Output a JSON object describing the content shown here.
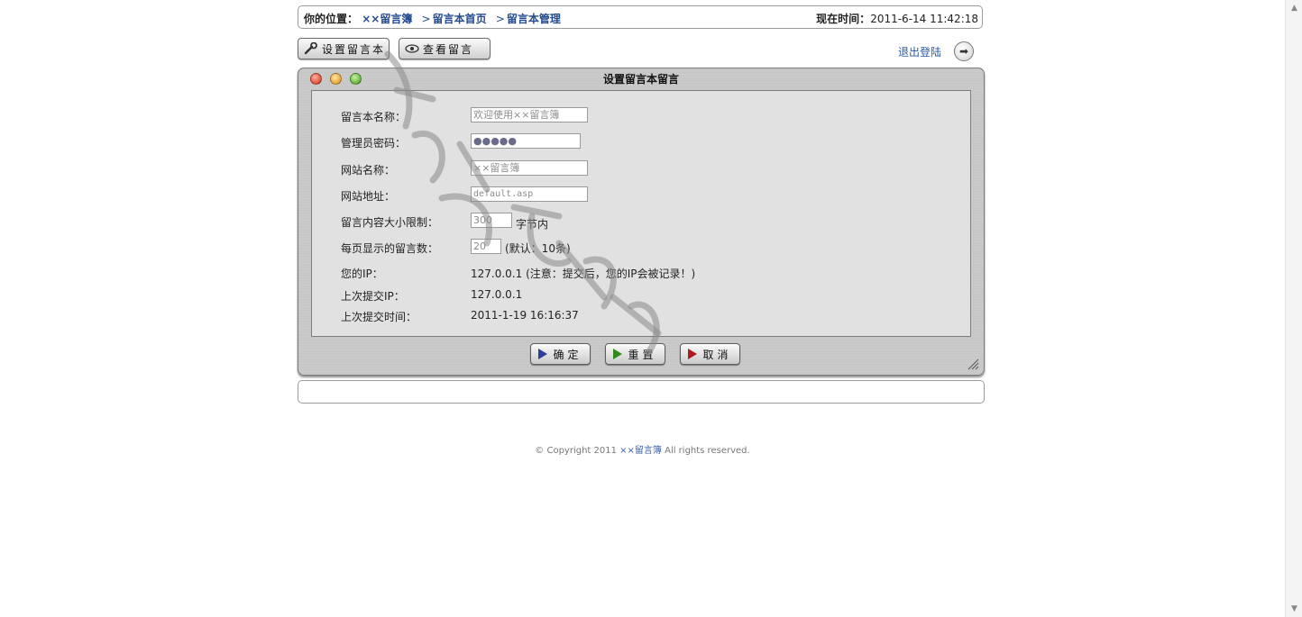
{
  "breadcrumb": {
    "label": "你的位置：",
    "items": [
      "××留言簿",
      "留言本首页",
      "留言本管理"
    ],
    "separator": ">"
  },
  "clock": {
    "label": "现在时间：",
    "value": "2011-6-14 11:42:18"
  },
  "toolbar": {
    "settings_label": "设置留言本",
    "view_label": "查看留言",
    "logout_label": "退出登陆"
  },
  "panel": {
    "title": "设置留言本留言",
    "fields": [
      {
        "label": "留言本名称：",
        "value": "欢迎使用××留言簿"
      },
      {
        "label": "管理员密码：",
        "value": "●●●●●"
      },
      {
        "label": "网站名称：",
        "value": "××留言簿"
      },
      {
        "label": "网站地址：",
        "value": "default.asp"
      },
      {
        "label": "留言内容大小限制：",
        "value": "300",
        "suffix": "字节内"
      },
      {
        "label": "每页显示的留言数：",
        "value": "20",
        "suffix": "(默认：10条)"
      }
    ],
    "info": [
      {
        "label": "您的IP：",
        "value": "127.0.0.1 (注意：提交后，您的IP会被记录！)"
      },
      {
        "label": "上次提交IP：",
        "value": "127.0.0.1"
      },
      {
        "label": "上次提交时间：",
        "value": "2011-1-19 16:16:37"
      }
    ],
    "buttons": {
      "confirm": "确定",
      "reset": "重置",
      "cancel": "取消"
    }
  },
  "footer": {
    "prefix": "© Copyright 2011 ",
    "brand": "××留言簿",
    "suffix": " All rights reserved."
  },
  "colors": {
    "link": "#244a8f",
    "confirm_icon": "#2a3f9e",
    "reset_icon": "#2e8a1c",
    "cancel_icon": "#b01a1a"
  }
}
